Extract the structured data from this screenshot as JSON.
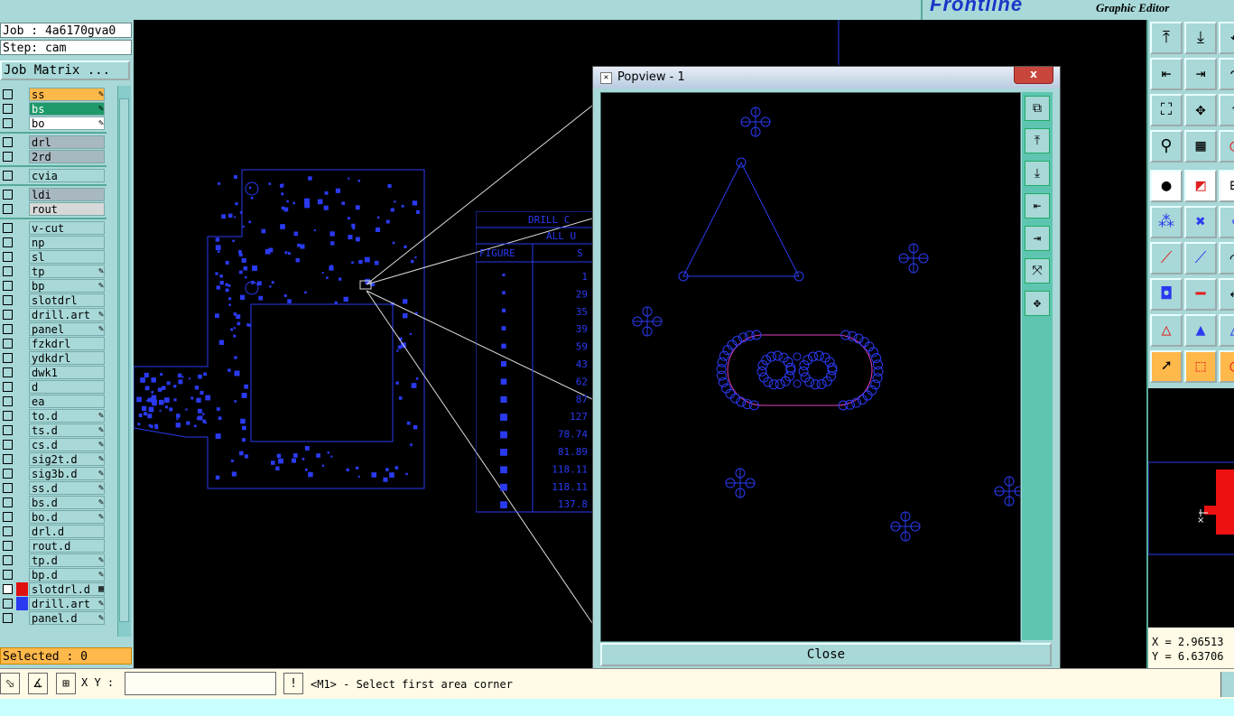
{
  "top": {
    "brand_logo": "Frontline",
    "brand_subtitle": "Graphic Editor"
  },
  "left": {
    "job": "Job : 4a6170gva0",
    "step": "Step: cam",
    "job_matrix_button": "Job Matrix ...",
    "selected": "Selected : 0",
    "layers": [
      {
        "name": "ss",
        "color": "#ffb84a",
        "icon": "pencil-icon"
      },
      {
        "name": "bs",
        "color": "#1e9a6a",
        "icon": "pencil-icon"
      },
      {
        "name": "bo",
        "color": "#ffffff",
        "icon": "pencil-icon"
      },
      {
        "name": "drl",
        "color": "#a8b8c0",
        "icon": ""
      },
      {
        "name": "2rd",
        "color": "#a8b8c0",
        "icon": ""
      },
      {
        "name": "cvia",
        "color": "#a8d8d8",
        "icon": ""
      },
      {
        "name": "ldi",
        "color": "#a8b8c0",
        "icon": ""
      },
      {
        "name": "rout",
        "color": "#d8d8d8",
        "icon": ""
      },
      {
        "name": "v-cut",
        "color": "#a8d8d8",
        "icon": ""
      },
      {
        "name": "np",
        "color": "#a8d8d8",
        "icon": ""
      },
      {
        "name": "sl",
        "color": "#a8d8d8",
        "icon": ""
      },
      {
        "name": "tp",
        "color": "#a8d8d8",
        "icon": "pencil-icon"
      },
      {
        "name": "bp",
        "color": "#a8d8d8",
        "icon": "pencil-icon"
      },
      {
        "name": "slotdrl",
        "color": "#a8d8d8",
        "icon": ""
      },
      {
        "name": "drill.art",
        "color": "#a8d8d8",
        "icon": "pencil-icon"
      },
      {
        "name": "panel",
        "color": "#a8d8d8",
        "icon": "pencil-icon"
      },
      {
        "name": "fzkdrl",
        "color": "#a8d8d8",
        "icon": ""
      },
      {
        "name": "ydkdrl",
        "color": "#a8d8d8",
        "icon": ""
      },
      {
        "name": "dwk1",
        "color": "#a8d8d8",
        "icon": ""
      },
      {
        "name": "d",
        "color": "#a8d8d8",
        "icon": ""
      },
      {
        "name": "ea",
        "color": "#a8d8d8",
        "icon": ""
      },
      {
        "name": "to.d",
        "color": "#a8d8d8",
        "icon": "pencil-icon"
      },
      {
        "name": "ts.d",
        "color": "#a8d8d8",
        "icon": "pencil-icon"
      },
      {
        "name": "cs.d",
        "color": "#a8d8d8",
        "icon": "pencil-icon"
      },
      {
        "name": "sig2t.d",
        "color": "#a8d8d8",
        "icon": "pencil-icon"
      },
      {
        "name": "sig3b.d",
        "color": "#a8d8d8",
        "icon": "pencil-icon"
      },
      {
        "name": "ss.d",
        "color": "#a8d8d8",
        "icon": "pencil-icon"
      },
      {
        "name": "bs.d",
        "color": "#a8d8d8",
        "icon": "pencil-icon"
      },
      {
        "name": "bo.d",
        "color": "#a8d8d8",
        "icon": "pencil-icon"
      },
      {
        "name": "drl.d",
        "color": "#a8d8d8",
        "icon": ""
      },
      {
        "name": "rout.d",
        "color": "#a8d8d8",
        "icon": ""
      },
      {
        "name": "tp.d",
        "color": "#a8d8d8",
        "icon": "pencil-icon"
      },
      {
        "name": "bp.d",
        "color": "#a8d8d8",
        "icon": "pencil-icon"
      },
      {
        "name": "slotdrl.d",
        "color": "#a8d8d8",
        "icon": "grid-icon",
        "swatch": "#e01010",
        "checked": true
      },
      {
        "name": "drill.art",
        "color": "#a8d8d8",
        "icon": "pencil-icon",
        "swatch": "#2a3af0"
      },
      {
        "name": "panel.d",
        "color": "#a8d8d8",
        "icon": "pencil-icon"
      }
    ]
  },
  "drill_table": {
    "title": "DRILL C",
    "subtitle": "ALL U",
    "col_figure": "FIGURE",
    "col_size": "S",
    "sizes": [
      "1",
      "29",
      "35",
      "39",
      "59",
      "43",
      "62",
      "87",
      "127",
      "78.74",
      "81.89",
      "118.11",
      "118.11",
      "137.8"
    ]
  },
  "popview": {
    "title": "Popview - 1",
    "close_x": "x",
    "close_button": "Close"
  },
  "bottom": {
    "xy_label": "X Y :",
    "xy_value": "",
    "info_icon": "!",
    "status": "<M1> - Select first area corner"
  },
  "coords": {
    "x": "X = 2.96513",
    "y": "Y = 6.63706"
  }
}
